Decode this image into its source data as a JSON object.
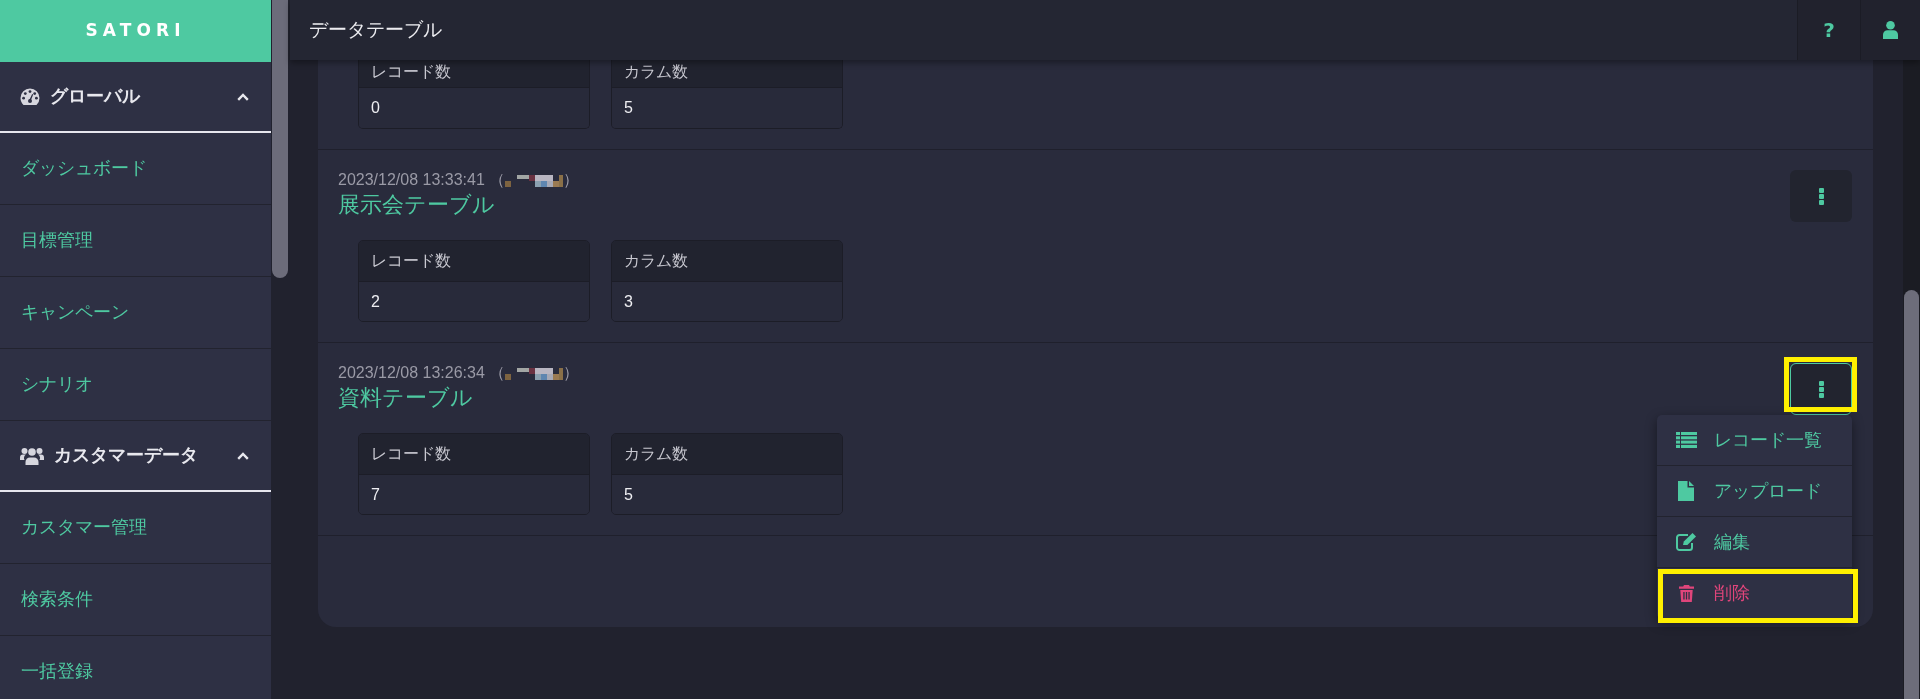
{
  "sidebar": {
    "logo": "SATORI",
    "sections": [
      {
        "label": "グローバル",
        "expanded": true,
        "items": [
          {
            "label": "ダッシュボード"
          },
          {
            "label": "目標管理"
          },
          {
            "label": "キャンペーン"
          },
          {
            "label": "シナリオ"
          }
        ]
      },
      {
        "label": "カスタマーデータ",
        "expanded": true,
        "items": [
          {
            "label": "カスタマー管理"
          },
          {
            "label": "検索条件"
          },
          {
            "label": "一括登録"
          }
        ]
      }
    ]
  },
  "top_bar": {
    "title": "データテーブル",
    "help_button": "?"
  },
  "tables": [
    {
      "stats": [
        {
          "label": "レコード数",
          "value": "0"
        },
        {
          "label": "カラム数",
          "value": "5"
        }
      ]
    },
    {
      "updated_at": "2023/12/08 13:33:41",
      "author_open": "（",
      "author_close": "）",
      "title": "展示会テーブル",
      "menu_open": false,
      "highlighted": false,
      "stats": [
        {
          "label": "レコード数",
          "value": "2"
        },
        {
          "label": "カラム数",
          "value": "3"
        }
      ]
    },
    {
      "updated_at": "2023/12/08 13:26:34",
      "author_open": "（",
      "author_close": "）",
      "title": "資料テーブル",
      "menu_open": true,
      "highlighted": true,
      "stats": [
        {
          "label": "レコード数",
          "value": "7"
        },
        {
          "label": "カラム数",
          "value": "5"
        }
      ],
      "menu": [
        {
          "label": "レコード一覧",
          "color": "#4ec9a1",
          "highlighted": false
        },
        {
          "label": "アップロード",
          "color": "#4ec9a1",
          "highlighted": false
        },
        {
          "label": "編集",
          "color": "#4ec9a1",
          "highlighted": false
        },
        {
          "label": "削除",
          "color": "#e0457b",
          "highlighted": true
        }
      ]
    }
  ]
}
